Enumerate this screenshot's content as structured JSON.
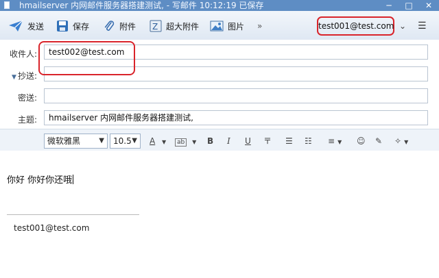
{
  "window": {
    "title": "hmailserver 内网邮件服务器搭建测试,   - 写邮件   10:12:19 已保存",
    "minimize_label": "─",
    "maximize_label": "□",
    "close_label": "✕"
  },
  "toolbar": {
    "send_label": "发送",
    "save_label": "保存",
    "attach_label": "附件",
    "big_attach_label": "超大附件",
    "image_label": "图片",
    "more_label": "»",
    "account": "test001@test.com",
    "account_dropdown": "⌄",
    "menu_icon": "☰",
    "send_icon_color": "#3a7fd0"
  },
  "form": {
    "to_label": "收件人:",
    "to_value": "test002@test.com",
    "cc_label": "抄送:",
    "cc_value": "",
    "bcc_label": "密送:",
    "bcc_value": "",
    "subject_label": "主题:",
    "subject_value": "hmailserver 内网邮件服务器搭建测试,",
    "cc_toggle": "▼"
  },
  "format_bar": {
    "font_family": "微软雅黑",
    "font_size": "10.5",
    "bold": "B",
    "italic": "I",
    "underline": "U",
    "strike": "〒"
  },
  "body": {
    "text": "你好 你好你还哦",
    "signature": "test001@test.com"
  },
  "highlight_color": "#d9232a"
}
